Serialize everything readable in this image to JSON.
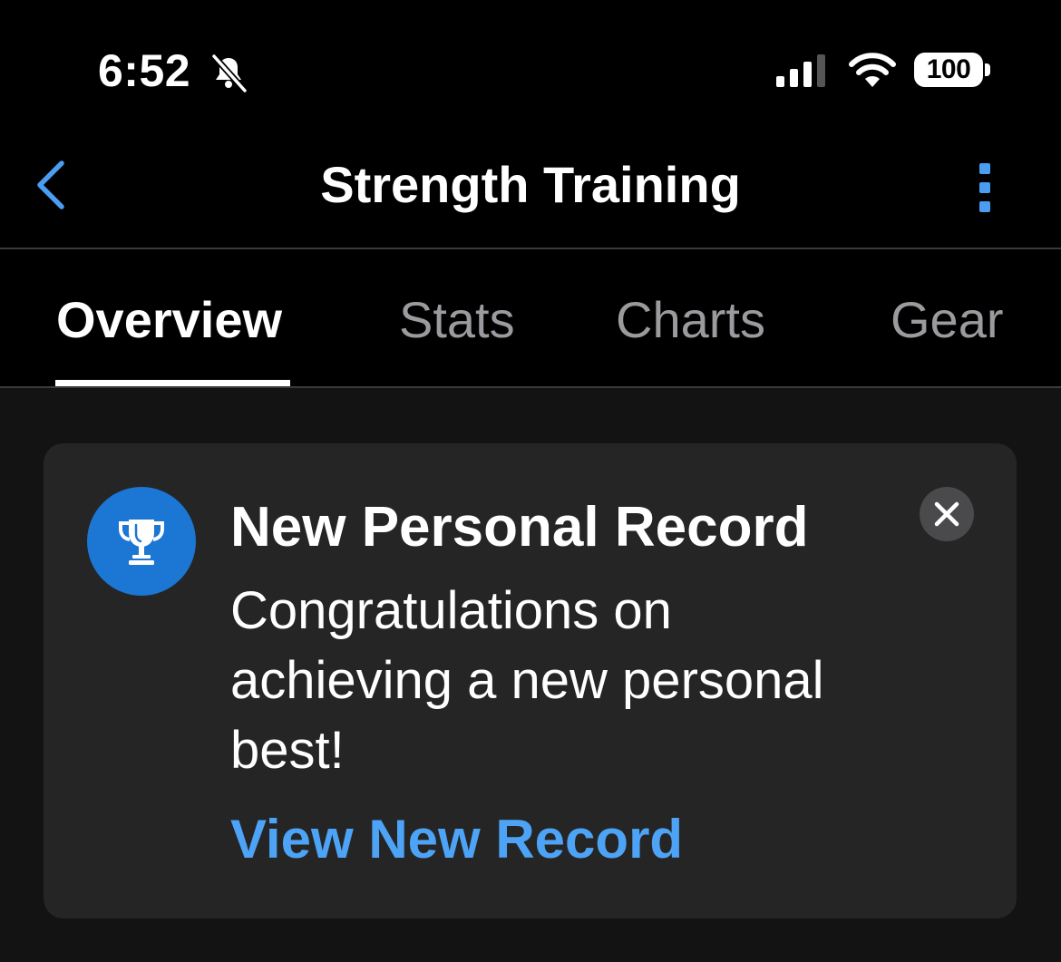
{
  "status_bar": {
    "time": "6:52",
    "battery": "100",
    "icons": [
      "bell-slash-icon",
      "cellular-signal-icon",
      "wifi-icon",
      "battery-icon"
    ]
  },
  "nav": {
    "title": "Strength Training",
    "back_icon": "chevron-left-icon",
    "more_icon": "more-vertical-icon",
    "accent_color": "#4a9df0"
  },
  "tabs": [
    {
      "label": "Overview",
      "active": true
    },
    {
      "label": "Stats",
      "active": false
    },
    {
      "label": "Charts",
      "active": false
    },
    {
      "label": "Gear",
      "active": false
    }
  ],
  "notification_card": {
    "icon": "trophy-icon",
    "icon_bg_color": "#1b76d4",
    "title": "New Personal Record",
    "message": "Congratulations on achieving a new personal best!",
    "link_label": "View New Record",
    "link_color": "#4da3f5",
    "close_icon": "close-icon"
  }
}
